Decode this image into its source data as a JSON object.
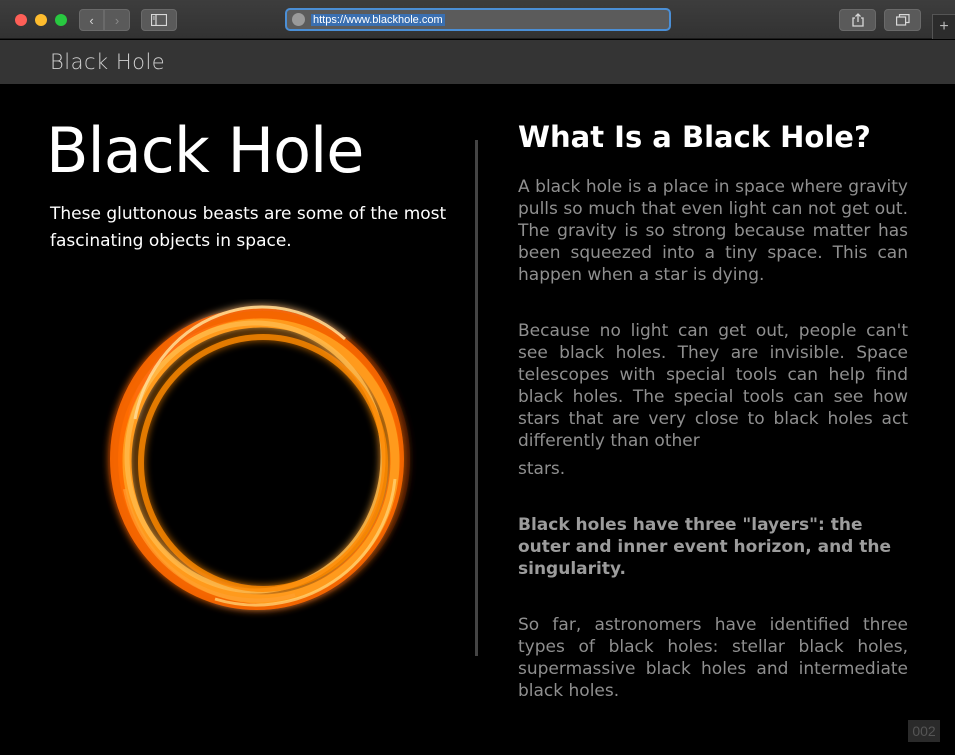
{
  "browser": {
    "url": "https://www.blackhole.com",
    "icons": {
      "back": "chevron-left-icon",
      "forward": "chevron-right-icon",
      "sidebar": "sidebar-icon",
      "share": "share-icon",
      "tabs": "tabs-icon",
      "new_tab": "plus-icon"
    }
  },
  "site": {
    "logo": "Black Hole"
  },
  "hero": {
    "title": "Black Hole",
    "subtitle": "These gluttonous beasts are some of the most fascinating objects in space."
  },
  "article": {
    "heading": "What Is a Black Hole?",
    "p1": "A black hole is a place in space where gravity pulls so much that even light can not get out. The gravity is so strong because matter has been squeezed into a tiny space. This can happen when a star is dying.",
    "p2": "Because no light can get out, people can't see black holes. They are invisible. Space telescopes with special tools can help find black holes. The special tools can see how stars that are very close to black holes act differently than other",
    "p2_tail": "stars.",
    "p3": "Black holes have three \"layers\": the outer and inner event horizon, and the singularity.",
    "p4": "So far, astronomers have identified three types of black holes: stellar black holes, supermassive black holes and intermediate black holes."
  },
  "page_badge": "002",
  "colors": {
    "background": "#000000",
    "header": "#343434",
    "ring_outer": "#ff7a00",
    "ring_inner": "#ffd070",
    "body_text": "#8f8f8f"
  }
}
